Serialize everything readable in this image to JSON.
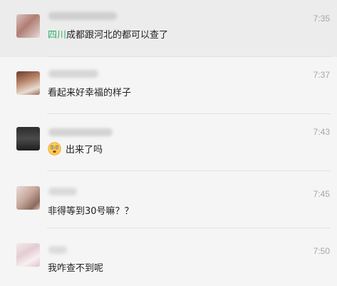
{
  "chats": [
    {
      "time": "7:35",
      "message_highlight": "四川",
      "message_rest": "成都跟河北的都可以查了"
    },
    {
      "time": "7:37",
      "message": "看起来好幸福的样子"
    },
    {
      "time": "7:43",
      "emoji_icon": "worried-face-icon",
      "message": "出来了吗"
    },
    {
      "time": "7:45",
      "message": "非得等到30号嘛？？"
    },
    {
      "time": "7:50",
      "message": "我咋查不到呢"
    }
  ],
  "colors": {
    "background": "#f5f5f5",
    "selected_row": "#ececec",
    "highlight_text": "#2aae67",
    "time_text": "#a6a6a6"
  }
}
